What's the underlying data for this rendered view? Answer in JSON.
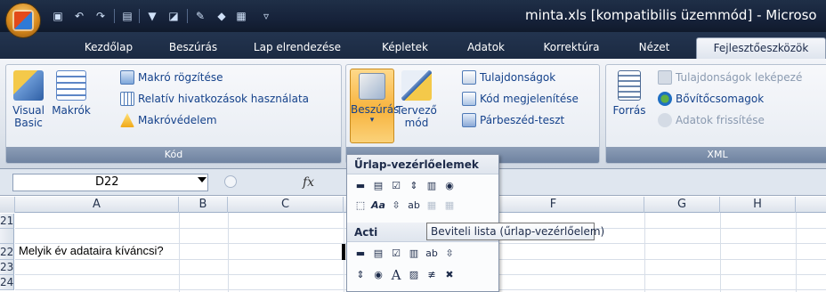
{
  "title": "minta.xls  [kompatibilis üzemmód]  -  Microso",
  "tabs": [
    "Kezdőlap",
    "Beszúrás",
    "Lap elrendezése",
    "Képletek",
    "Adatok",
    "Korrektúra",
    "Nézet",
    "Fejlesztőeszközök"
  ],
  "ribbon": {
    "kod": {
      "visual_basic": "Visual Basic",
      "makrok": "Makrók",
      "makro_rogzitese": "Makró rögzítése",
      "relativ": "Relatív hivatkozások használata",
      "makrovedelem": "Makróvédelem",
      "label": "Kód"
    },
    "vezerlok": {
      "beszuras": "Beszúrás",
      "tervezo_mod": "Tervező mód",
      "tulajdonsagok": "Tulajdonságok",
      "kod_megjelenitese": "Kód megjelenítése",
      "parbeszed_teszt": "Párbeszéd-teszt"
    },
    "xml": {
      "forras": "Forrás",
      "tulajdonsagok_lekepezes": "Tulajdonságok leképezé",
      "bovitocsomagok": "Bővítőcsomagok",
      "adatok_frissitese": "Adatok frissítése",
      "label": "XML"
    }
  },
  "formula_bar": {
    "name_box": "D22",
    "fx": "fx"
  },
  "columns": [
    "A",
    "B",
    "C",
    "F",
    "G",
    "H"
  ],
  "rows": [
    "21",
    "22",
    "23",
    "24"
  ],
  "cells": {
    "A22": "Melyik év adataira kíváncsi?"
  },
  "dropdown": {
    "header1": "Űrlap-vezérlőelemek",
    "header2": "Acti"
  },
  "tooltip": "Beviteli lista (űrlap-vezérlőelem)"
}
